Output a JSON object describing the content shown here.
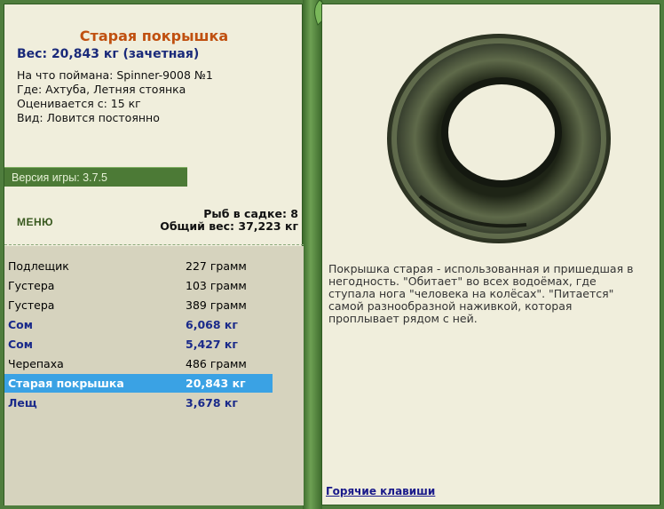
{
  "fish": {
    "title": "Старая покрышка",
    "weight": "Вес: 20,843 кг (зачетная)",
    "caught_with": "На что поймана: Spinner-9008 №1",
    "where": "Где: Ахтуба, Летняя стоянка",
    "rated_from": "Оценивается с: 15 кг",
    "kind": "Вид: Ловится постоянно"
  },
  "version": "Версия игры: 3.7.5",
  "menu_label": "МЕНЮ",
  "stats": {
    "count": "Рыб в садке: 8",
    "total_weight": "Общий вес: 37,223 кг"
  },
  "catch": [
    {
      "name": "Подлещик",
      "weight": "227 грамм"
    },
    {
      "name": "Густера",
      "weight": "103 грамм"
    },
    {
      "name": "Густера",
      "weight": "389 грамм"
    },
    {
      "name": "Сом",
      "weight": "6,068 кг"
    },
    {
      "name": "Сом",
      "weight": "5,427 кг"
    },
    {
      "name": "Черепаха",
      "weight": "486 грамм"
    },
    {
      "name": "Старая покрышка",
      "weight": "20,843 кг"
    },
    {
      "name": "Лещ",
      "weight": "3,678 кг"
    }
  ],
  "description": "Покрышка старая - использованная и пришедшая в негодность. \"Обитает\" во всех водоёмах, где ступала нога \"человека на колёсах\". \"Питается\" самой разнообразной наживкой, которая проплывает рядом с ней.",
  "hotkeys_label": "Горячие клавиши",
  "colors": {
    "selected_row": "#3aa2e4",
    "trophy_text": "#1a2a8a",
    "title_text": "#c05010"
  }
}
